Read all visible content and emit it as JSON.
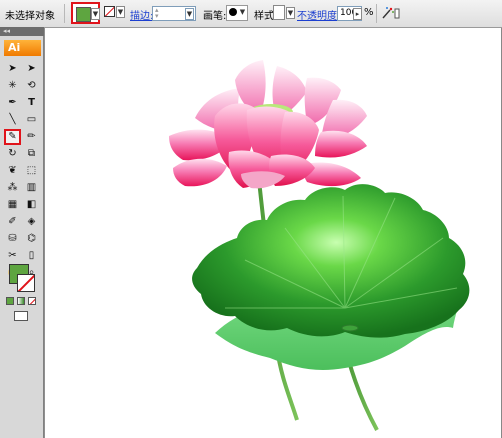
{
  "control_bar": {
    "selection_status": "未选择对象",
    "stroke_label": "描边:",
    "brush_label": "画笔:",
    "style_label": "样式:",
    "opacity_label": "不透明度:",
    "opacity_value": "100",
    "opacity_unit": "%"
  },
  "colors": {
    "fill": "#5ea540",
    "highlight": "#e0141b",
    "accent": "#f07a00"
  },
  "toolbox": {
    "logo": "Ai",
    "collapse": "◂◂",
    "highlighted_tool": "paintbrush-tool"
  }
}
